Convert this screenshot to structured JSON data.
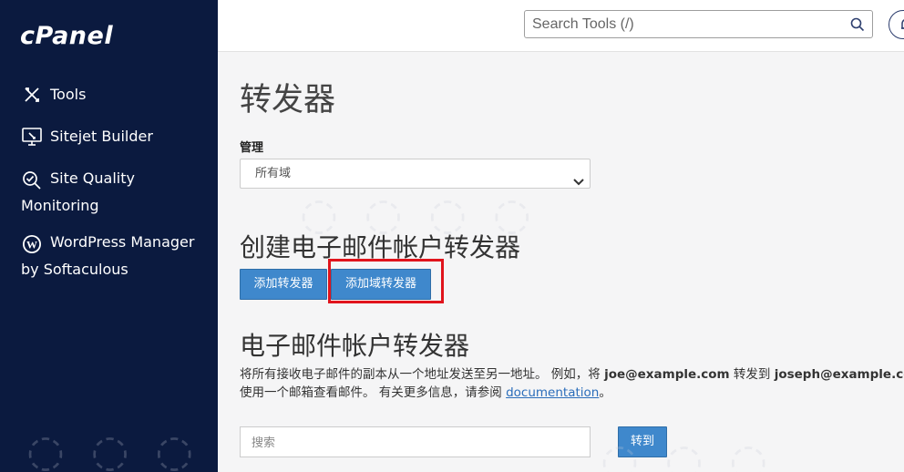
{
  "sidebar": {
    "logo": "cPanel",
    "items": [
      {
        "label": "Tools",
        "icon": "tools-icon"
      },
      {
        "label": "Sitejet Builder",
        "icon": "sitejet-icon"
      },
      {
        "label_line1": "Site Quality",
        "label_line2": "Monitoring",
        "icon": "site-quality-icon"
      },
      {
        "label_line1": "WordPress Manager",
        "label_line2": "by Softaculous",
        "icon": "wordpress-icon"
      }
    ]
  },
  "header": {
    "search_placeholder": "Search Tools (/)",
    "search_icon": "search-icon",
    "bell_icon": "bell-icon"
  },
  "main": {
    "title": "转发器",
    "manage_label": "管理",
    "domain_select_value": "所有域",
    "create_section_title": "创建电子邮件帐户转发器",
    "add_forwarder_button": "添加转发器",
    "add_domain_forwarder_button": "添加域转发器",
    "forwarders_section_title": "电子邮件帐户转发器",
    "desc_line1_prefix": "将所有接收电子邮件的副本从一个地址发送至另一地址。 例如，将 ",
    "desc_example_from": "joe@example.com",
    "desc_line1_mid": " 转发到 ",
    "desc_example_to": "joseph@example.co",
    "desc_line2_prefix": "使用一个邮箱查看邮件。 有关更多信息，请参阅 ",
    "desc_link": "documentation",
    "desc_line2_suffix": "。",
    "search_placeholder": "搜索",
    "go_button": "转到"
  },
  "colors": {
    "sidebar_bg": "#0b1a3f",
    "button_blue": "#3f88cc",
    "highlight_red": "#e0141c"
  }
}
